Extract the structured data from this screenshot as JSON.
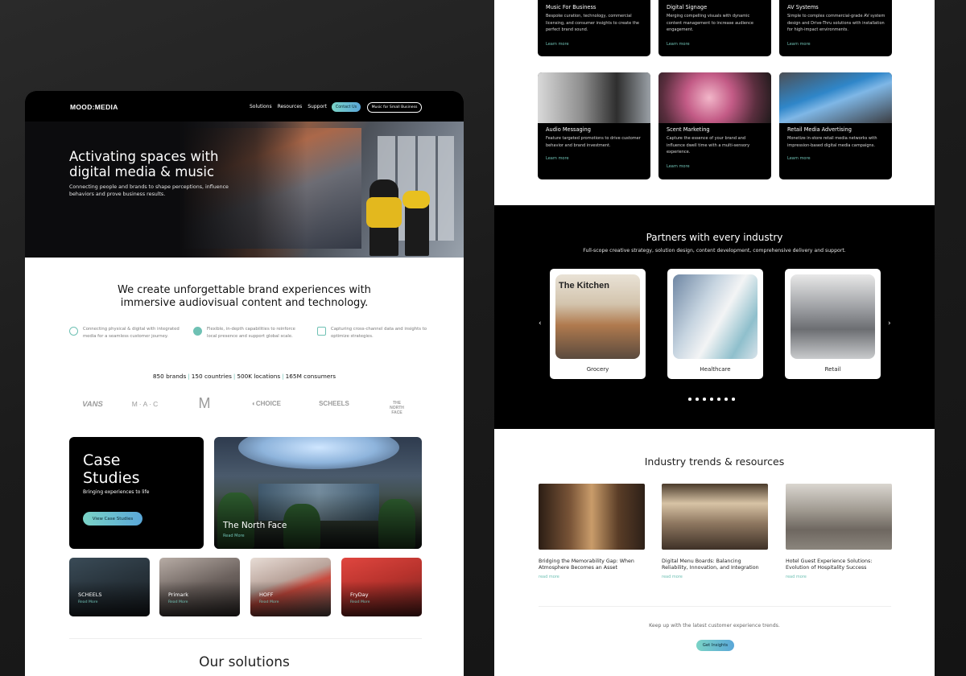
{
  "left_page": {
    "nav": {
      "logo": "MOOD:MEDIA",
      "links": [
        "Solutions",
        "Resources",
        "Support"
      ],
      "contact_button": "Contact Us",
      "small_business_button": "Music for Small Business"
    },
    "hero": {
      "title": "Activating spaces with digital media & music",
      "subtitle": "Connecting people and brands to shape perceptions, influence behaviors and prove business results."
    },
    "intro": {
      "headline": "We create unforgettable brand experiences with immersive audiovisual content and technology."
    },
    "features": [
      {
        "icon": "check-circle-icon",
        "text": "Connecting physical & digital with integrated media for a seamless customer journey."
      },
      {
        "icon": "globe-icon",
        "text": "Flexible, in-depth capabilities to reinforce local presence and support global scale."
      },
      {
        "icon": "bar-chart-icon",
        "text": "Capturing cross-channel data and insights to optimize strategies."
      }
    ],
    "stats": [
      "850 brands",
      "150 countries",
      "500K locations",
      "165M consumers"
    ],
    "brands": [
      "VANS",
      "MAC",
      "McDonald's",
      "CHOICE HOTELS",
      "SCHEELS",
      "THE NORTH FACE"
    ],
    "case_studies": {
      "title": "Case Studies",
      "subtitle": "Bringing experiences to life",
      "button": "View Case Studies",
      "featured": {
        "name": "The North Face",
        "read_more": "Read More"
      },
      "items": [
        {
          "name": "SCHEELS",
          "read_more": "Read More"
        },
        {
          "name": "Primark",
          "read_more": "Read More"
        },
        {
          "name": "HOFF",
          "read_more": "Read More"
        },
        {
          "name": "FryDay",
          "read_more": "Read More"
        }
      ]
    },
    "solutions_heading": "Our solutions"
  },
  "right_page": {
    "solutions": [
      {
        "title": "Music For Business",
        "desc": "Bespoke curation, technology, commercial licensing, and consumer insights to create the perfect brand sound.",
        "link": "Learn more"
      },
      {
        "title": "Digital Signage",
        "desc": "Merging compelling visuals with dynamic content management to increase audience engagement.",
        "link": "Learn more"
      },
      {
        "title": "AV Systems",
        "desc": "Simple to complex commercial-grade AV system design and Drive-Thru solutions with installation for high-impact environments.",
        "link": "Learn more"
      },
      {
        "title": "Audio Messaging",
        "desc": "Feature targeted promotions to drive customer behavior and brand investment.",
        "link": "Learn more"
      },
      {
        "title": "Scent Marketing",
        "desc": "Capture the essence of your brand and influence dwell time with a multi-sensory experience.",
        "link": "Learn more"
      },
      {
        "title": "Retail Media Advertising",
        "desc": "Monetize in-store retail media networks with impression-based digital media campaigns.",
        "link": "Learn more"
      }
    ],
    "partners": {
      "title": "Partners with every industry",
      "subtitle": "Full-scope creative strategy, solution design, content development, comprehensive delivery and support.",
      "industries": [
        "Grocery",
        "Healthcare",
        "Retail"
      ],
      "kitchen_sign": "The Kitchen",
      "prev_arrow": "‹",
      "next_arrow": "›",
      "dot_count": 7
    },
    "trends": {
      "title": "Industry trends & resources",
      "articles": [
        {
          "title": "Bridging the Memorability Gap: When Atmosphere Becomes an Asset",
          "link": "read more"
        },
        {
          "title": "Digital Menu Boards: Balancing Reliability, Innovation, and Integration",
          "link": "read more"
        },
        {
          "title": "Hotel Guest Experience Solutions: Evolution of Hospitality Success",
          "link": "read more"
        }
      ],
      "keep_up": "Keep up with the latest customer experience trends.",
      "button": "Get Insights"
    }
  },
  "colors": {
    "accent_teal": "#6fc1b4",
    "button_gradient_start": "#7ad3c6",
    "button_gradient_end": "#5aa7d8",
    "background": "#1b1b1b"
  }
}
